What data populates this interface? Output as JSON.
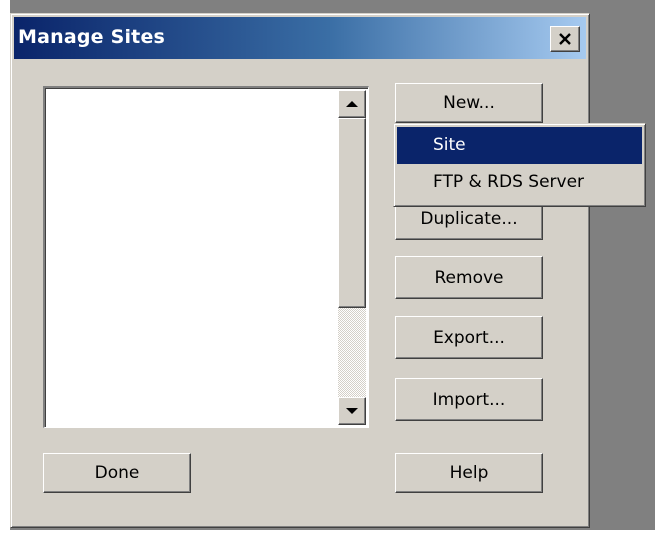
{
  "dialog": {
    "title": "Manage Sites",
    "close_label": "×"
  },
  "sites_list": {
    "items": []
  },
  "buttons": {
    "new": "New...",
    "duplicate": "Duplicate...",
    "remove": "Remove",
    "export": "Export...",
    "import": "Import...",
    "done": "Done",
    "help": "Help"
  },
  "new_menu": {
    "items": [
      {
        "label": "Site",
        "selected": true
      },
      {
        "label": "FTP & RDS Server",
        "selected": false
      }
    ]
  },
  "icons": {
    "close": "close-icon",
    "scroll_up": "arrow-up-icon",
    "scroll_down": "arrow-down-icon"
  },
  "colors": {
    "titlebar_start": "#0a246a",
    "titlebar_end": "#a6caf0",
    "dialog_face": "#d4d0c8",
    "selection": "#0a246a"
  }
}
